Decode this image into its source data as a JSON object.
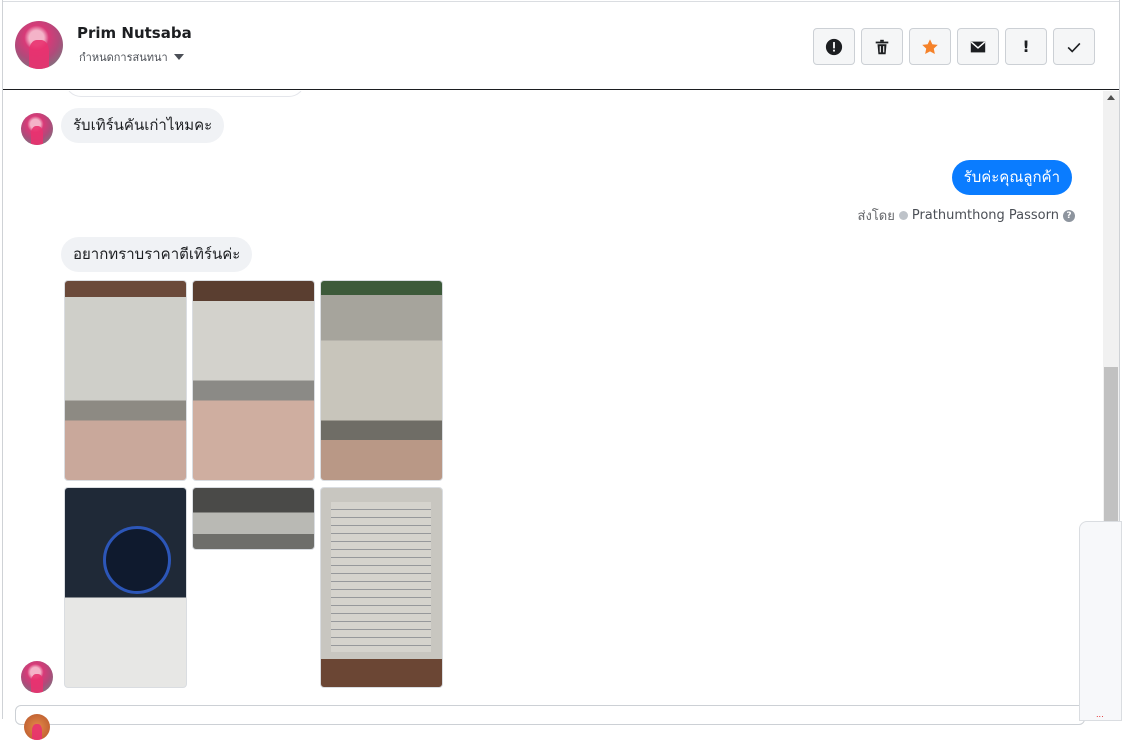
{
  "header": {
    "contact_name": "Prim Nutsaba",
    "subtitle": "กำหนดการสนทนา",
    "tools": [
      {
        "name": "alert-icon",
        "label": ""
      },
      {
        "name": "trash-icon",
        "label": ""
      },
      {
        "name": "star-icon",
        "label": ""
      },
      {
        "name": "mail-icon",
        "label": ""
      },
      {
        "name": "exclamation-icon",
        "label": "!"
      },
      {
        "name": "check-icon",
        "label": ""
      }
    ],
    "star_color": "#f5822a"
  },
  "thread": {
    "messages": [
      {
        "side": "in",
        "text": "รับเทิร์นคันเก่าไหมคะ"
      },
      {
        "side": "out",
        "text": "รับค่ะคุณลูกค้า"
      },
      {
        "side": "in",
        "text": "อยากทราบราคาตีเทิร์นค่ะ"
      }
    ],
    "sent_by_prefix": "ส่งโดย",
    "sent_by_name": "Prathumthong Passorn",
    "help_icon": "?",
    "photo_count": 6
  },
  "colors": {
    "outgoing_bubble": "#0a7cff",
    "incoming_bubble": "#f0f2f5"
  },
  "side_panel": {
    "mark": "..."
  }
}
